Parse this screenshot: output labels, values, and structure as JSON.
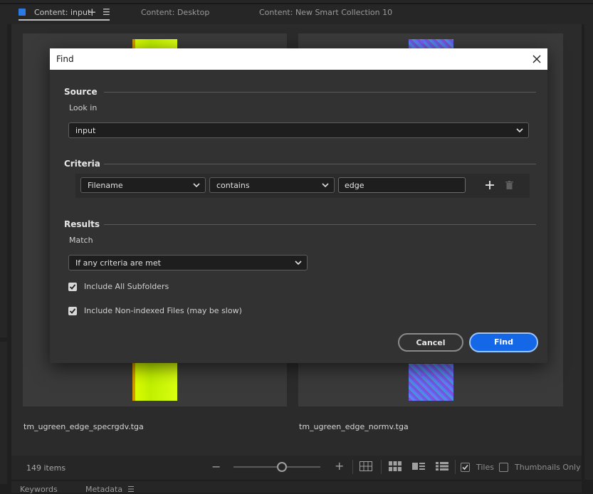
{
  "tabs": [
    {
      "label": "Content: input",
      "active": true
    },
    {
      "label": "Content: Desktop",
      "active": false
    },
    {
      "label": "Content: New Smart Collection 10",
      "active": false
    }
  ],
  "tab_icons": {
    "add": "+",
    "menu": "☰"
  },
  "files": [
    {
      "name": "tm_ugreen_edge_specrgdv.tga",
      "thumb": "yellow-green-texture"
    },
    {
      "name": "tm_ugreen_edge_normv.tga",
      "thumb": "blue-noise-texture"
    }
  ],
  "status": {
    "items": "149 items",
    "zoom_minus": "−",
    "zoom_plus": "+",
    "tiles_label": "Tiles",
    "tiles_checked": true,
    "thumbnails_only_label": "Thumbnails Only",
    "thumbnails_only_checked": false
  },
  "bottom_tabs": {
    "keywords": "Keywords",
    "metadata": "Metadata",
    "menu": "☰"
  },
  "dialog": {
    "title": "Find",
    "source": {
      "heading": "Source",
      "look_in_label": "Look in",
      "look_in_value": "input"
    },
    "criteria": {
      "heading": "Criteria",
      "field": "Filename",
      "operator": "contains",
      "value": "edge"
    },
    "results": {
      "heading": "Results",
      "match_label": "Match",
      "match_value": "If any criteria are met",
      "include_subfolders": "Include All Subfolders",
      "include_subfolders_checked": true,
      "include_nonindexed": "Include Non-indexed Files (may be slow)",
      "include_nonindexed_checked": true
    },
    "buttons": {
      "cancel": "Cancel",
      "find": "Find"
    }
  },
  "colors": {
    "accent": "#1467e6",
    "tab_square": "#2b7be5"
  }
}
